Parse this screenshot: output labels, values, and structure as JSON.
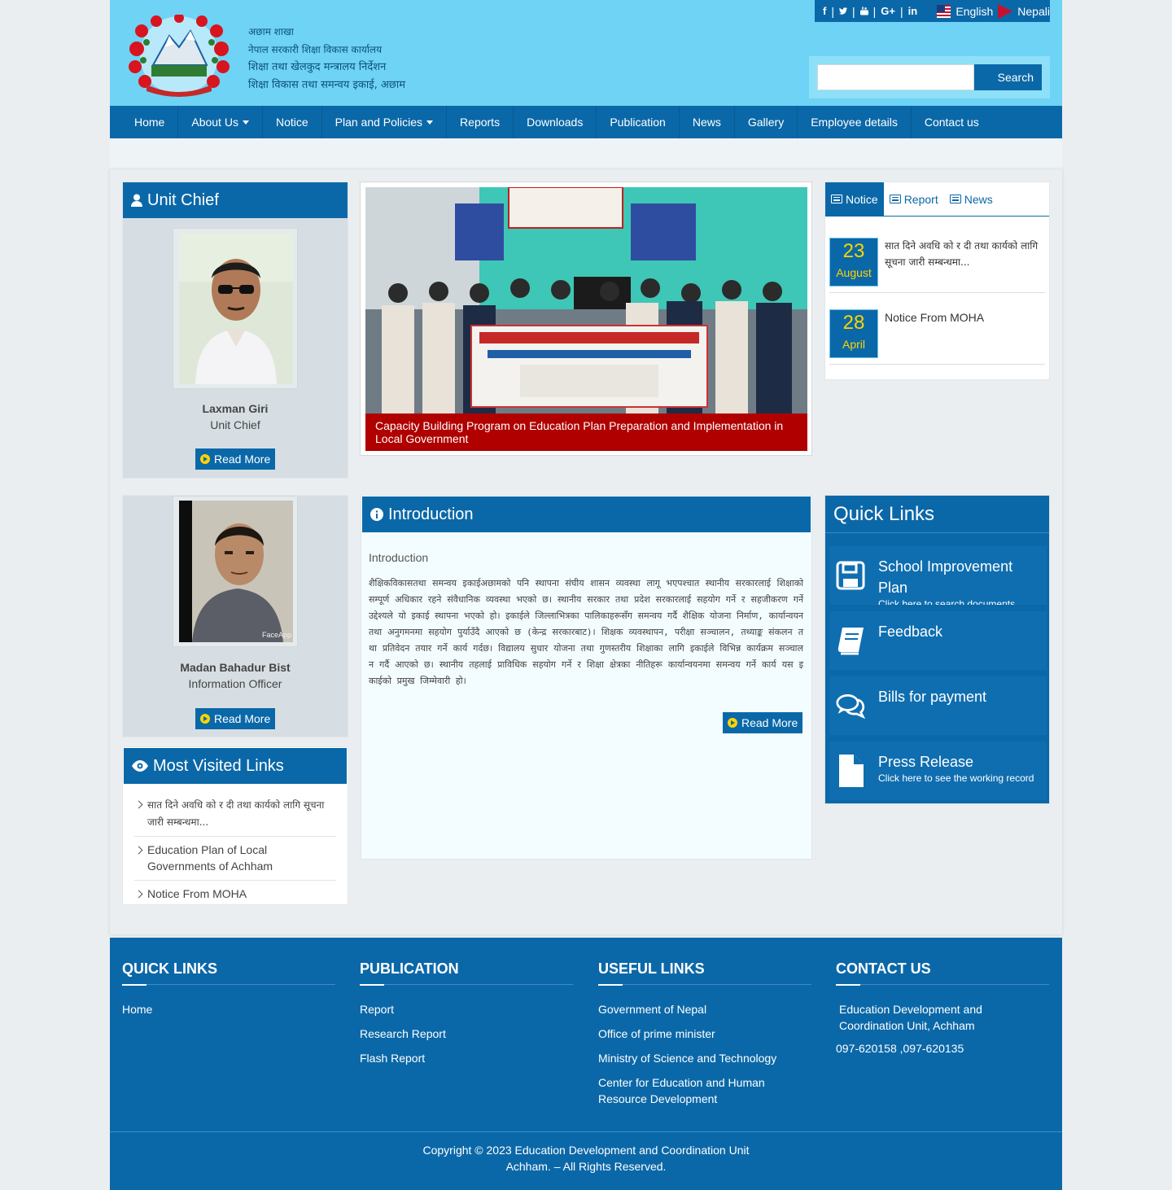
{
  "header": {
    "gov_lines": [
      "अछाम शाखा",
      "नेपाल सरकारी शिक्षा विकास कार्यालय",
      "शिक्षा तथा खेलकुद मन्त्रालय निर्देशन",
      "शिक्षा विकास तथा समन्वय इकाई, अछाम"
    ],
    "social": {
      "facebook": "f",
      "twitter": "t",
      "youtube": "yt",
      "google": "G+",
      "linkedin": "in"
    },
    "lang_en": "English",
    "lang_np": "Nepali",
    "search_button": "Search",
    "search_placeholder": ""
  },
  "nav": {
    "items": [
      "Home",
      "About Us",
      "Notice",
      "Plan and Policies",
      "Reports",
      "Downloads",
      "Publication",
      "News",
      "Gallery",
      "Employee details",
      "Contact us"
    ]
  },
  "unit_chief": {
    "heading": "Unit Chief",
    "name": "Laxman Giri",
    "role": "Unit Chief",
    "button": "Read More"
  },
  "slider": {
    "caption": "Capacity Building Program on Education Plan Preparation and Implementation in Local Government"
  },
  "tabs": {
    "items": [
      "Notice",
      "Report",
      "News"
    ],
    "active": "Notice",
    "notices": [
      {
        "day": "23",
        "month": "August",
        "text": "सात दिने अवधि को र दी तथा कार्यको लागि सूचना जारी सम्बन्धमा..."
      },
      {
        "day": "28",
        "month": "April",
        "text": "Notice From MOHA"
      }
    ]
  },
  "officer": {
    "name": "Madan Bahadur Bist",
    "role": "Information Officer",
    "button": "Read More",
    "watermark": "FaceApp"
  },
  "most_visited": {
    "heading": "Most Visited Links",
    "items": [
      "सात दिने अवधि को र दी तथा कार्यको लागि सूचना जारी सम्बन्धमा...",
      "Education Plan of Local Governments of Achham",
      "Notice From MOHA"
    ]
  },
  "introduction": {
    "heading": "Introduction",
    "title": "Introduction",
    "body": "शैक्षिकविकासतथा समन्वय इकाईअछामको पनि स्थापना संघीय शासन व्यवस्था लागू भएपश्चात स्थानीय सरकारलाई शिक्षाको सम्पूर्ण अधिकार रहने संवैधानिक व्यवस्था भएको छ। स्थानीय सरकार तथा प्रदेश सरकारलाई सहयोग गर्ने र सहजीकरण गर्ने उद्देश्यले यो इकाई स्थापना भएको हो। इकाईले जिल्लाभित्रका पालिकाहरूसँग समन्वय गर्दै शैक्षिक योजना निर्माण, कार्यान्वयन तथा अनुगमनमा सहयोग पुर्याउँदै आएको छ (केन्द्र सरकारबाट)। शिक्षक व्यवस्थापन, परीक्षा सञ्चालन, तथ्याङ्क संकलन तथा प्रतिवेदन तयार गर्ने कार्य गर्दछ। विद्यालय सुधार योजना तथा गुणस्तरीय शिक्षाका लागि इकाईले विभिन्न कार्यक्रम सञ्चालन गर्दै आएको छ। स्थानीय तहलाई प्राविधिक सहयोग गर्ने र शिक्षा क्षेत्रका नीतिहरू कार्यान्वयनमा समन्वय गर्ने कार्य यस इकाईको प्रमुख जिम्मेवारी हो।",
    "button": "Read More"
  },
  "quick_links": {
    "heading": "Quick Links",
    "items": [
      {
        "title": "School Improvement Plan",
        "sub": "Click here to search documents",
        "icon": "save-icon"
      },
      {
        "title": "Feedback",
        "sub": "",
        "icon": "book-icon"
      },
      {
        "title": "Bills for payment",
        "sub": "",
        "icon": "comments-icon"
      },
      {
        "title": "Press Release",
        "sub": "Click here to see the working record",
        "icon": "file-icon"
      }
    ]
  },
  "footer": {
    "quick_links": {
      "heading": "QUICK LINKS",
      "items": [
        "Home"
      ]
    },
    "publication": {
      "heading": "PUBLICATION",
      "items": [
        "Report",
        "Research Report",
        "Flash Report"
      ]
    },
    "useful_links": {
      "heading": "USEFUL LINKS",
      "items": [
        "Government of Nepal",
        "Office of prime minister",
        "Ministry of Science and Technology",
        "Center for Education and Human Resource Development"
      ]
    },
    "contact": {
      "heading": "CONTACT US",
      "address": "Education Development and Coordination Unit, Achham",
      "phone": "097-620158 ,097-620135"
    },
    "copyright": "Copyright © 2023 Education Development and Coordination Unit Achham. – All Rights Reserved."
  },
  "colors": {
    "header_bg": "#6ed3f5",
    "primary": "#0b68a8",
    "caption_bg": "#b00000",
    "date_text": "#ffd400"
  }
}
